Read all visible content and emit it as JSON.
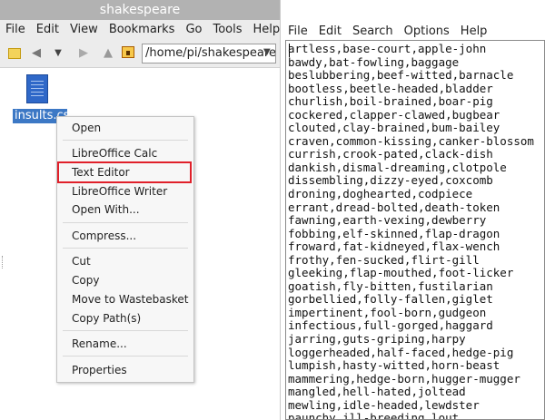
{
  "file_manager": {
    "title": "shakespeare",
    "menu": [
      "File",
      "Edit",
      "View",
      "Bookmarks",
      "Go",
      "Tools",
      "Help"
    ],
    "path": "/home/pi/shakespeare",
    "file_name": "insults.csv"
  },
  "context_menu": {
    "items": [
      "Open",
      "LibreOffice Calc",
      "Text Editor",
      "LibreOffice Writer",
      "Open With...",
      "Compress...",
      "Cut",
      "Copy",
      "Move to Wastebasket",
      "Copy Path(s)",
      "Rename...",
      "Properties"
    ],
    "highlighted": "Text Editor",
    "highlight_color": "#e0202a"
  },
  "editor": {
    "menu": [
      "File",
      "Edit",
      "Search",
      "Options",
      "Help"
    ],
    "lines": [
      "artless,base-court,apple-john",
      "bawdy,bat-fowling,baggage",
      "beslubbering,beef-witted,barnacle",
      "bootless,beetle-headed,bladder",
      "churlish,boil-brained,boar-pig",
      "cockered,clapper-clawed,bugbear",
      "clouted,clay-brained,bum-bailey",
      "craven,common-kissing,canker-blossom",
      "currish,crook-pated,clack-dish",
      "dankish,dismal-dreaming,clotpole",
      "dissembling,dizzy-eyed,coxcomb",
      "droning,doghearted,codpiece",
      "errant,dread-bolted,death-token",
      "fawning,earth-vexing,dewberry",
      "fobbing,elf-skinned,flap-dragon",
      "froward,fat-kidneyed,flax-wench",
      "frothy,fen-sucked,flirt-gill",
      "gleeking,flap-mouthed,foot-licker",
      "goatish,fly-bitten,fustilarian",
      "gorbellied,folly-fallen,giglet",
      "impertinent,fool-born,gudgeon",
      "infectious,full-gorged,haggard",
      "jarring,guts-griping,harpy",
      "loggerheaded,half-faced,hedge-pig",
      "lumpish,hasty-witted,horn-beast",
      "mammering,hedge-born,hugger-mugger",
      "mangled,hell-hated,joltead",
      "mewling,idle-headed,lewdster",
      "paunchy,ill-breeding,lout"
    ]
  }
}
